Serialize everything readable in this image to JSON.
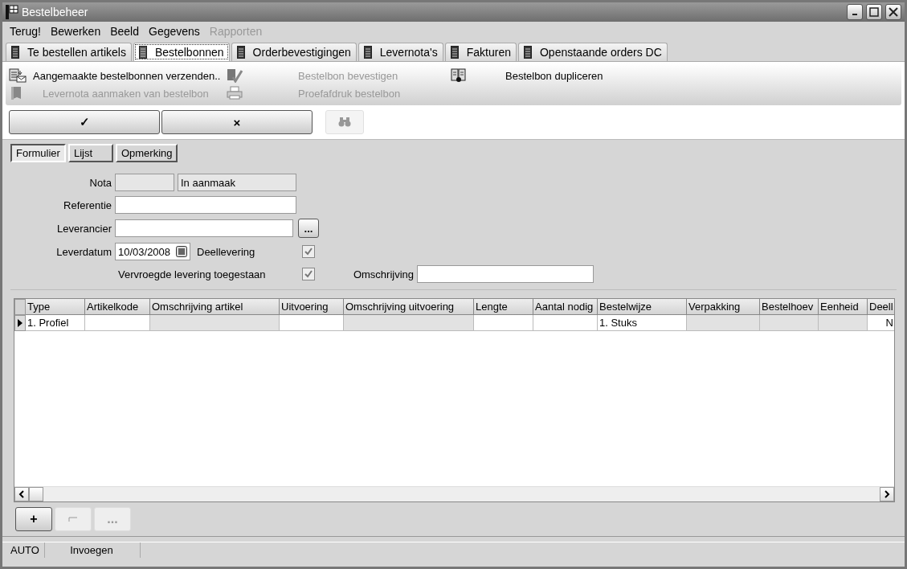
{
  "window": {
    "title": "Bestelbeheer"
  },
  "menu": [
    {
      "label": "Terug!",
      "disabled": false
    },
    {
      "label": "Bewerken",
      "disabled": false
    },
    {
      "label": "Beeld",
      "disabled": false
    },
    {
      "label": "Gegevens",
      "disabled": false
    },
    {
      "label": "Rapporten",
      "disabled": true
    }
  ],
  "tabs": [
    {
      "label": "Te bestellen artikels",
      "selected": false
    },
    {
      "label": "Bestelbonnen",
      "selected": true
    },
    {
      "label": "Orderbevestigingen",
      "selected": false
    },
    {
      "label": "Levernota's",
      "selected": false
    },
    {
      "label": "Fakturen",
      "selected": false
    },
    {
      "label": "Openstaande orders DC",
      "selected": false
    }
  ],
  "actions": [
    {
      "label": "Aangemaakte bestelbonnen verzenden..",
      "disabled": false
    },
    {
      "label": "Bestelbon bevestigen",
      "disabled": true
    },
    {
      "label": "Bestelbon dupliceren",
      "disabled": false
    },
    {
      "label": "Levernota aanmaken van bestelbon",
      "disabled": true
    },
    {
      "label": "Proefafdruk bestelbon",
      "disabled": true
    }
  ],
  "toolbar": {
    "confirm": "✓",
    "cancel": "×",
    "find_disabled": true
  },
  "subtabs": [
    {
      "label": "Formulier",
      "selected": true
    },
    {
      "label": "Lijst",
      "selected": false
    },
    {
      "label": "Opmerking",
      "selected": false
    }
  ],
  "form": {
    "nota": {
      "label": "Nota",
      "status": "In aanmaak"
    },
    "referentie": {
      "label": "Referentie"
    },
    "leverancier": {
      "label": "Leverancier",
      "browse": "..."
    },
    "leverdatum": {
      "label": "Leverdatum",
      "value": "10/03/2008"
    },
    "deellevering": {
      "label": "Deellevering",
      "checked": true
    },
    "vervroegd": {
      "label": "Vervroegde levering toegestaan",
      "checked": true
    },
    "omschrijving": {
      "label": "Omschrijving"
    }
  },
  "grid": {
    "columns": [
      "Type",
      "Artikelkode",
      "Omschrijving artikel",
      "Uitvoering",
      "Omschrijving uitvoering",
      "Lengte",
      "Aantal nodig",
      "Bestelwijze",
      "Verpakking",
      "Bestelhoev",
      "Eenheid",
      "Deell"
    ],
    "rows": [
      {
        "current": true,
        "cells": [
          {
            "text": "1. Profiel",
            "readonly": false
          },
          {
            "text": "",
            "readonly": false
          },
          {
            "text": "",
            "readonly": true
          },
          {
            "text": "",
            "readonly": false
          },
          {
            "text": "",
            "readonly": true
          },
          {
            "text": "",
            "readonly": false
          },
          {
            "text": "",
            "readonly": false
          },
          {
            "text": "1. Stuks",
            "readonly": false
          },
          {
            "text": "",
            "readonly": true
          },
          {
            "text": "",
            "readonly": true
          },
          {
            "text": "",
            "readonly": true
          },
          {
            "text": "N",
            "readonly": false
          }
        ]
      }
    ]
  },
  "row_buttons": [
    {
      "kind": "add",
      "label": "+",
      "disabled": false
    },
    {
      "kind": "icon",
      "disabled": true
    },
    {
      "kind": "more",
      "label": "...",
      "disabled": true
    }
  ],
  "status_bar": [
    "AUTO",
    "Invoegen"
  ]
}
